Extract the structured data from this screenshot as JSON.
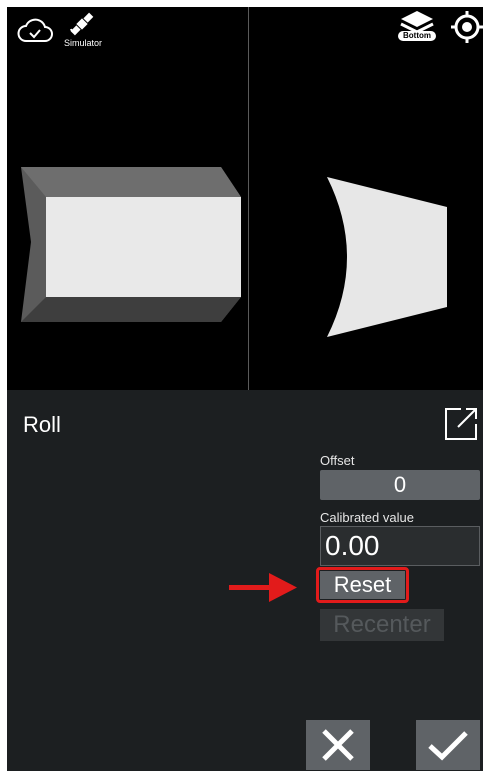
{
  "toolbar": {
    "simulator_label": "Simulator",
    "layers_label": "Bottom",
    "icons": [
      "cloud-check-icon",
      "satellite-icon",
      "layers-icon",
      "target-icon"
    ]
  },
  "panel": {
    "title": "Roll",
    "offset_label": "Offset",
    "offset_value": "0",
    "calibrated_label": "Calibrated value",
    "calibrated_value": "0.00",
    "reset_label": "Reset",
    "recenter_label": "Recenter"
  },
  "colors": {
    "viewport_bg": "#000000",
    "panel_bg": "#1c1f21",
    "button_bg": "#5f6367",
    "highlight": "#e21b1b"
  }
}
